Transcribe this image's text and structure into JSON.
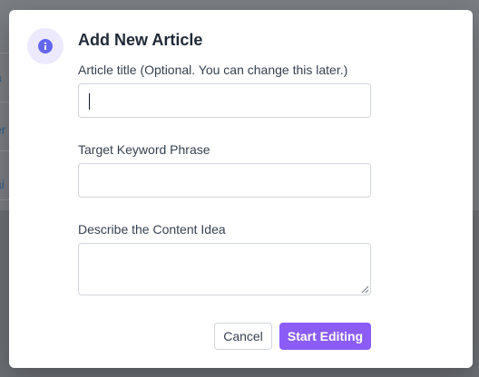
{
  "background": {
    "link_fragments": [
      "a",
      "er",
      "ai"
    ]
  },
  "modal": {
    "icon": "info-icon",
    "title": "Add New Article",
    "fields": {
      "title": {
        "label": "Article title (Optional. You can change this later.)",
        "value": "",
        "placeholder": ""
      },
      "keyword": {
        "label": "Target Keyword Phrase",
        "value": "",
        "placeholder": ""
      },
      "idea": {
        "label": "Describe the Content Idea",
        "value": "",
        "placeholder": ""
      }
    },
    "buttons": {
      "cancel": "Cancel",
      "start": "Start Editing"
    }
  },
  "colors": {
    "accent": "#8b5cf6",
    "icon_bg": "#ede9fe",
    "icon_fg": "#6366f1",
    "overlay": "#6b6e73"
  }
}
